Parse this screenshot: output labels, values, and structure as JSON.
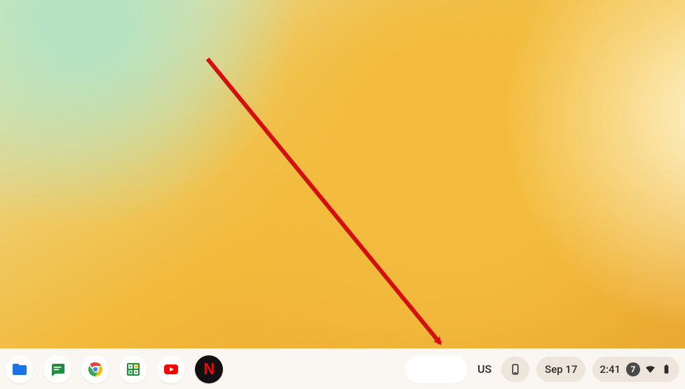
{
  "shelf": {
    "apps": {
      "files": {
        "name": "files-app-icon",
        "color": "#1a73e8"
      },
      "chat": {
        "name": "google-chat-icon",
        "color": "#1e8e3e"
      },
      "chrome": {
        "name": "chrome-icon"
      },
      "sheets": {
        "name": "calculator-icon"
      },
      "youtube": {
        "name": "youtube-icon",
        "color": "#ff0000"
      },
      "netflix": {
        "name": "netflix-icon",
        "letter": "N"
      }
    }
  },
  "ime": {
    "label": "US"
  },
  "calendar": {
    "date_label": "Sep 17"
  },
  "status": {
    "time": "2:41",
    "notification_count": "7"
  },
  "colors": {
    "shelf_bg": "#faf6f1",
    "pill_bg": "#eee6dc",
    "arrow": "#d30f0f"
  }
}
